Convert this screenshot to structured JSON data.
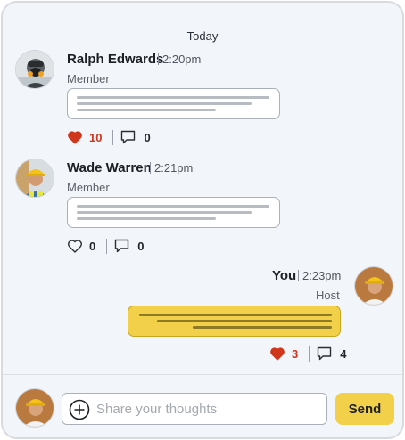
{
  "divider": {
    "label": "Today"
  },
  "messages": [
    {
      "name": "Ralph Edwards",
      "time": "2:20pm",
      "role": "Member",
      "likes": "10",
      "liked": true,
      "comments": "0"
    },
    {
      "name": "Wade Warren",
      "time": "2:21pm",
      "role": "Member",
      "likes": "0",
      "liked": false,
      "comments": "0"
    },
    {
      "name": "You",
      "time": "2:23pm",
      "role": "Host",
      "likes": "3",
      "liked": true,
      "comments": "4"
    }
  ],
  "composer": {
    "placeholder": "Share your thoughts",
    "value": "",
    "send_label": "Send"
  },
  "colors": {
    "accent": "#f2d04a",
    "like": "#d0361c",
    "background": "#f2f5f9"
  },
  "icons": [
    "heart-icon",
    "comment-icon",
    "plus-circle-icon"
  ]
}
